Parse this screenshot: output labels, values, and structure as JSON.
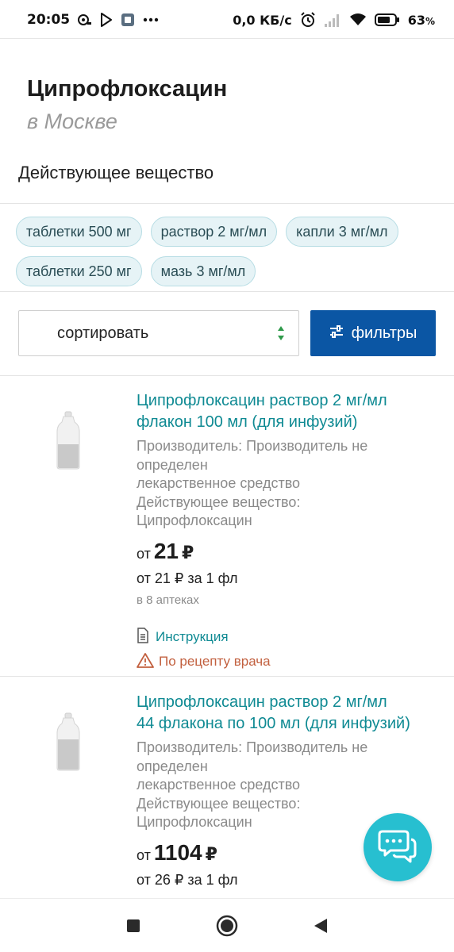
{
  "status_bar": {
    "time": "20:05",
    "speed": "0,0 КБ/с",
    "battery": "63",
    "battery_unit": "%",
    "icons": [
      "recorder-icon",
      "play-store-icon",
      "app-icon",
      "more-dots-icon",
      "alarm-icon",
      "signal-icon",
      "wifi-icon",
      "battery-icon"
    ]
  },
  "header": {
    "title": "Ципрофлоксацин",
    "subtitle": "в Москве"
  },
  "section": {
    "label": "Действующее вещество"
  },
  "chips": [
    {
      "label": "таблетки 500 мг"
    },
    {
      "label": "раствор 2 мг/мл"
    },
    {
      "label": "капли 3 мг/мл"
    },
    {
      "label": "таблетки 250 мг"
    },
    {
      "label": "мазь 3 мг/мл"
    }
  ],
  "controls": {
    "sort_label": "сортировать",
    "filters_label": "фильтры"
  },
  "products": [
    {
      "name_line1": "Ципрофлоксацин раствор 2 мг/мл",
      "name_line2": "флакон 100 мл (для инфузий)",
      "manufacturer_line1": "Производитель: Производитель не",
      "manufacturer_line2": "определен",
      "type": "лекарственное средство",
      "substance_label": "Действующее вещество:",
      "substance": "Ципрофлоксацин",
      "price_prefix": "от",
      "price": "21",
      "currency": "₽",
      "unit_price": "от 21 ₽ за 1 фл",
      "pharmacies": "в 8 аптеках",
      "instruction": "Инструкция",
      "rx": "По рецепту врача"
    },
    {
      "name_line1": "Ципрофлоксацин раствор 2 мг/мл",
      "name_line2": "44 флакона по 100 мл (для инфузий)",
      "manufacturer_line1": "Производитель: Производитель не",
      "manufacturer_line2": "определен",
      "type": "лекарственное средство",
      "substance_label": "Действующее вещество:",
      "substance": "Ципрофлоксацин",
      "price_prefix": "от",
      "price": "1104",
      "currency": "₽",
      "unit_price": "от 26 ₽ за 1 фл"
    }
  ],
  "colors": {
    "accent_teal": "#0f8a93",
    "chip_bg": "#e6f3f6",
    "filters_bg": "#0b56a4",
    "rx_orange": "#c2603f",
    "sort_arrows_green": "#2e9a4a",
    "chat_fab": "#27bfd0"
  },
  "nav_bar": {
    "buttons": [
      "recents-button",
      "home-button",
      "back-button"
    ]
  }
}
